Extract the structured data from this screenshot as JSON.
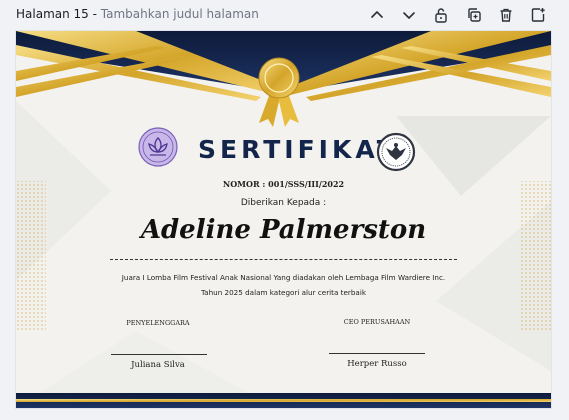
{
  "toolbar": {
    "page_label": "Halaman 15",
    "separator": " - ",
    "page_subtitle": "Tambahkan judul halaman",
    "icons": [
      "chevron-up-icon",
      "chevron-down-icon",
      "unlock-icon",
      "duplicate-icon",
      "trash-icon",
      "add-page-icon"
    ]
  },
  "certificate": {
    "title": "SERTIFIKAT",
    "number": "NOMOR : 001/SSS/III/2022",
    "given_to": "Diberikan Kepada :",
    "recipient": "Adeline Palmerston",
    "description_line1": "Juara I Lomba Film Festival Anak Nasional Yang diadakan oleh Lembaga Film Wardiere Inc.",
    "description_line2": "Tahun 2025 dalam kategori alur cerita terbaik",
    "signatory_left_role": "PENYELENGGARA",
    "signatory_left_name": "Juliana Silva",
    "signatory_right_role": "CEO PERUSAHAAN",
    "signatory_right_name": "Herper Russo",
    "colors": {
      "navy": "#13254a",
      "gold": "#d4a52a",
      "paper": "#f3f2ee"
    }
  }
}
